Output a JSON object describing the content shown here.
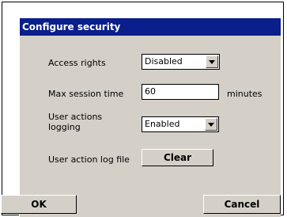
{
  "dialog": {
    "title": "Configure security"
  },
  "fields": {
    "access_rights": {
      "label": "Access rights",
      "value": "Disabled"
    },
    "max_session_time": {
      "label": "Max session time",
      "value": "60",
      "unit": "minutes"
    },
    "user_actions_logging": {
      "label_line1": "User actions",
      "label_line2": "logging",
      "value": "Enabled"
    },
    "user_action_log_file": {
      "label": "User action log file",
      "button": "Clear"
    }
  },
  "footer": {
    "ok": "OK",
    "cancel": "Cancel"
  }
}
